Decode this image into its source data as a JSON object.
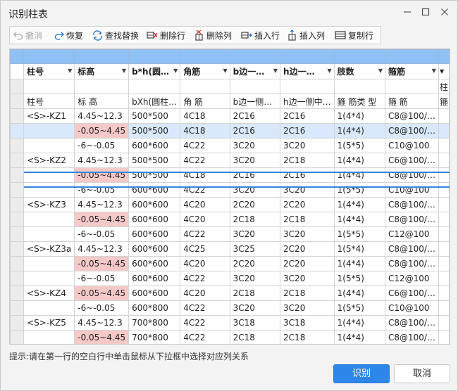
{
  "window": {
    "title": "识别柱表",
    "minimize_icon": "minimize-icon",
    "maximize_icon": "maximize-icon",
    "close_icon": "close-icon"
  },
  "toolbar": [
    {
      "label": "撤消",
      "icon": "undo-icon",
      "disabled": true
    },
    {
      "label": "恢复",
      "icon": "redo-icon",
      "disabled": false
    },
    {
      "label": "查找替换",
      "icon": "find-replace-icon",
      "disabled": false
    },
    {
      "label": "删除行",
      "icon": "delete-row-icon",
      "disabled": false
    },
    {
      "label": "删除列",
      "icon": "delete-column-icon",
      "disabled": false
    },
    {
      "label": "插入行",
      "icon": "insert-row-icon",
      "disabled": false
    },
    {
      "label": "插入列",
      "icon": "insert-column-icon",
      "disabled": false
    },
    {
      "label": "复制行",
      "icon": "copy-row-icon",
      "disabled": false
    }
  ],
  "grid": {
    "column_headers": [
      "柱号",
      "标高",
      "b*h(圆…",
      "角筋",
      "b边一…",
      "h边一…",
      "肢数",
      "箍筋",
      "▼"
    ],
    "extra_col_text": [
      "",
      "柱",
      "箍"
    ],
    "subheader": [
      "柱号",
      "标 高",
      "bXh(圆柱…",
      "角 筋",
      "b边一侧…",
      "h边一侧中…",
      "箍 筋类 型",
      "箍 筋",
      ""
    ],
    "selected_row_index": 1,
    "rows": [
      {
        "cells": [
          "<S>-KZ1",
          "4.45~12.3",
          "500*500",
          "4C18",
          "2C16",
          "2C16",
          "1(4*4)",
          "C8@100/…"
        ],
        "pink": []
      },
      {
        "cells": [
          "",
          "-0.05~4.45",
          "500*500",
          "4C18",
          "2C16",
          "2C16",
          "1(4*4)",
          "C8@100/…"
        ],
        "pink": [
          1
        ]
      },
      {
        "cells": [
          "",
          "-6~-0.05",
          "600*600",
          "4C22",
          "3C20",
          "3C20",
          "1(5*5)",
          "C10@100"
        ],
        "pink": []
      },
      {
        "cells": [
          "<S>-KZ2",
          "4.45~12.3",
          "500*500",
          "4C22",
          "3C20",
          "2C18",
          "1(4*4)",
          "C6@100/…"
        ],
        "pink": []
      },
      {
        "cells": [
          "",
          "-0.05~4.45",
          "500*500",
          "4C18",
          "2C16",
          "2C16",
          "1(4*4)",
          "C8@100/…"
        ],
        "pink": [
          1
        ]
      },
      {
        "cells": [
          "",
          "-6~-0.05",
          "600*600",
          "4C22",
          "3C20",
          "3C20",
          "1(5*5)",
          "C10@100"
        ],
        "pink": []
      },
      {
        "cells": [
          "<S>-KZ3",
          "4.45~12.3",
          "600*600",
          "4C20",
          "2C20",
          "2C20",
          "1(4*4)",
          "C8@100/…"
        ],
        "pink": []
      },
      {
        "cells": [
          "",
          "-0.05~4.45",
          "600*600",
          "4C20",
          "2C18",
          "2C18",
          "1(4*4)",
          "C8@100/…"
        ],
        "pink": [
          1
        ]
      },
      {
        "cells": [
          "",
          "-6~-0.05",
          "600*600",
          "4C22",
          "3C20",
          "3C20",
          "1(5*5)",
          "C12@100"
        ],
        "pink": []
      },
      {
        "cells": [
          "<S>-KZ3a",
          "4.45~12.3",
          "600*600",
          "4C25",
          "3C25",
          "2C20",
          "1(5*4)",
          "C8@100/…"
        ],
        "pink": []
      },
      {
        "cells": [
          "",
          "-0.05~4.45",
          "600*600",
          "4C20",
          "2C20",
          "2C20",
          "1(4*4)",
          "C8@100/…"
        ],
        "pink": [
          1
        ]
      },
      {
        "cells": [
          "",
          "-6~-0.05",
          "600*600",
          "4C22",
          "3C20",
          "3C20",
          "1(5*5)",
          "C12@100"
        ],
        "pink": []
      },
      {
        "cells": [
          "<S>-KZ4",
          "-0.05~4.45",
          "600*600",
          "4C20",
          "2C18",
          "2C18",
          "1(4*4)",
          "C6@100/…"
        ],
        "pink": [
          1
        ]
      },
      {
        "cells": [
          "",
          "-6~-0.05",
          "600*800",
          "4C22",
          "3C20",
          "3C20",
          "1(5*5)",
          "C10@100"
        ],
        "pink": []
      },
      {
        "cells": [
          "<S>-KZ5",
          "4.45~12.3",
          "700*800",
          "4C22",
          "3C18",
          "3C18",
          "1(4*4)",
          "C8@100/…"
        ],
        "pink": []
      },
      {
        "cells": [
          "",
          "-0.05~4.45",
          "700*800",
          "4C22",
          "2C18",
          "2C18",
          "1(4*4)",
          "C8@100/…"
        ],
        "pink": [
          1
        ]
      }
    ]
  },
  "hint": "提示:请在第一行的空白行中单击鼠标从下拉框中选择对应列关系",
  "buttons": {
    "ok": "识别",
    "cancel": "取消"
  }
}
